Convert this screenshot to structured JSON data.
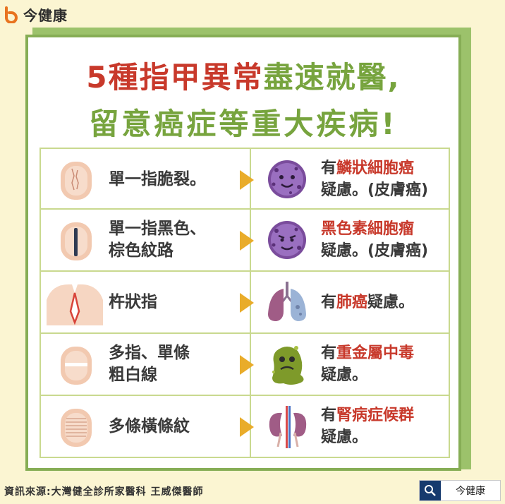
{
  "brand": {
    "name": "今健康",
    "icon": "jinjiankang-logo"
  },
  "headline": {
    "line1_red": "5種指甲異常",
    "line1_green": "盡速就醫,",
    "line2_green": "留意癌症等重大疾病!"
  },
  "rows": [
    {
      "symptom": [
        "單一指脆裂。"
      ],
      "illustration": "purple-cell-icon",
      "diagnosis": {
        "prefix": "有",
        "highlight": "鱗狀細胞癌",
        "suffix": "",
        "line2": "疑慮。(皮膚癌)"
      }
    },
    {
      "symptom": [
        "單一指黑色、",
        "棕色紋路"
      ],
      "illustration": "purple-cell-icon",
      "diagnosis": {
        "prefix": "",
        "highlight": "黑色素細胞瘤",
        "suffix": "",
        "line2": "疑慮。(皮膚癌)"
      }
    },
    {
      "symptom": [
        "杵狀指"
      ],
      "illustration": "lungs-icon",
      "diagnosis": {
        "prefix": "有",
        "highlight": "肺癌",
        "suffix": "疑慮。",
        "line2": ""
      }
    },
    {
      "symptom": [
        "多指、單條",
        "粗白線"
      ],
      "illustration": "toxic-blob-icon",
      "diagnosis": {
        "prefix": "有",
        "highlight": "重金屬中毒",
        "suffix": "",
        "line2": "疑慮。"
      }
    },
    {
      "symptom": [
        "多條橫條紋"
      ],
      "illustration": "kidneys-icon",
      "diagnosis": {
        "prefix": "有",
        "highlight": "腎病症候群",
        "suffix": "",
        "line2": "疑慮。"
      }
    }
  ],
  "footer": {
    "source": "資訊來源:大灣健全診所家醫科 王威傑醫師"
  },
  "search": {
    "label": "今健康",
    "icon": "search-icon"
  },
  "colors": {
    "accent_red": "#c8392b",
    "accent_green": "#77a43e",
    "arrow": "#e9ac2a",
    "background": "#fbf5d2"
  }
}
